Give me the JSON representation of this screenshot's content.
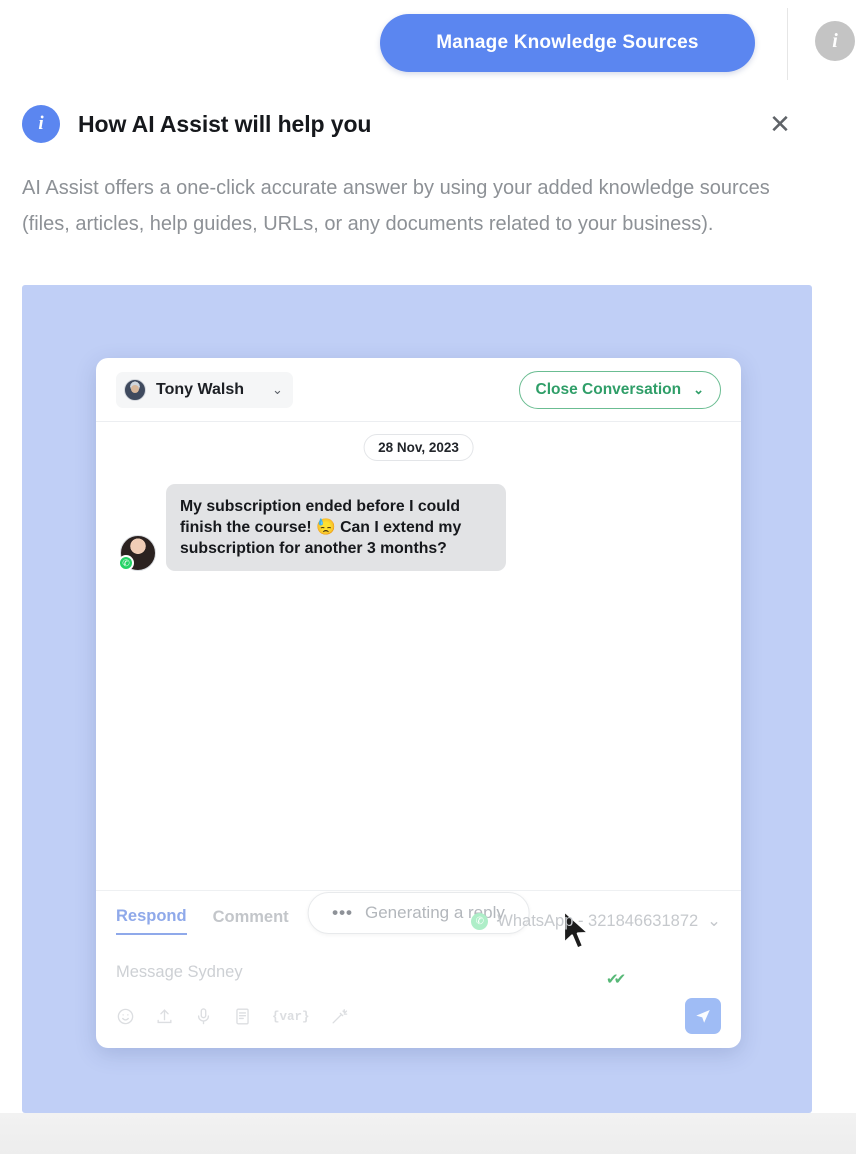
{
  "topbar": {
    "manage_button_label": "Manage Knowledge Sources",
    "info_icon_glyph": "i",
    "accent_color": "#5b86f0",
    "info_icon_color": "#c4c4c4"
  },
  "banner": {
    "icon_glyph": "i",
    "title": "How AI Assist will help you",
    "body": "AI Assist offers a one-click accurate answer by using your added knowledge sources (files, articles, help guides, URLs, or any documents related to your business).",
    "close_label": "✕",
    "icon_color": "#5b86f0"
  },
  "demo": {
    "background_color": "#c0cff6"
  },
  "widget": {
    "header": {
      "assignee_name": "Tony Walsh",
      "assignee_chevron": "⌄",
      "close_conversation_label": "Close Conversation",
      "close_conversation_chevron": "⌄",
      "close_conversation_color": "#2f9e68"
    },
    "conversation": {
      "date_divider": "28 Nov, 2023",
      "messages": [
        {
          "sender": "customer",
          "channel_badge": "whatsapp-icon",
          "text": "My subscription ended before I could finish the course! 😓 Can I extend my subscription for another 3 months?",
          "receipt": "✔✔",
          "receipt_color": "#57b877"
        }
      ],
      "status_pill": {
        "dots": "•••",
        "label": "Generating a reply"
      }
    },
    "composer": {
      "tabs": [
        {
          "label": "Respond",
          "active": true
        },
        {
          "label": "Comment",
          "active": false
        }
      ],
      "channel_label": "WhatsApp - 321846631872",
      "channel_chevron": "⌄",
      "message_placeholder": "Message Sydney",
      "tools": [
        {
          "name": "emoji-icon"
        },
        {
          "name": "attach-upload-icon"
        },
        {
          "name": "microphone-icon"
        },
        {
          "name": "canned-response-icon"
        },
        {
          "name": "variable-icon",
          "label": "{var}"
        },
        {
          "name": "magic-wand-icon"
        }
      ],
      "send_label": "➤",
      "send_color": "#9fbcf5"
    }
  }
}
